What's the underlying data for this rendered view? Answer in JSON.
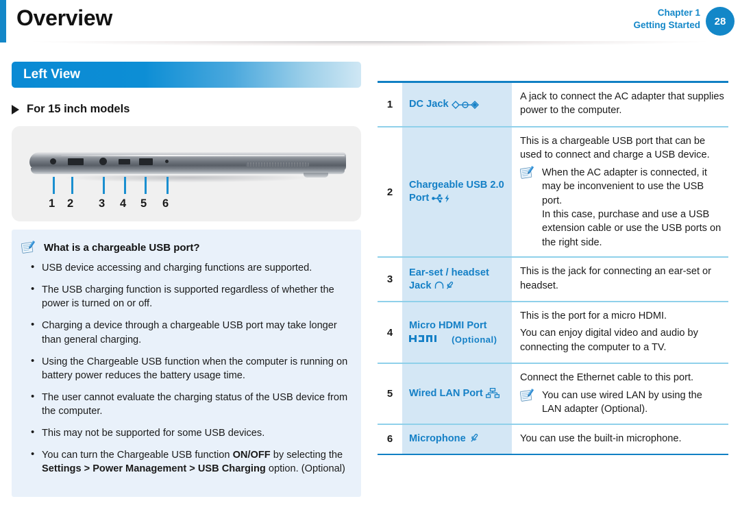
{
  "header": {
    "title": "Overview",
    "chapter": "Chapter 1",
    "subtitle": "Getting Started",
    "page_number": "28",
    "accent_color": "#1387c8"
  },
  "left": {
    "section_title": "Left View",
    "subheading": "For 15 inch models",
    "diagram": {
      "name": "laptop-left-side-view",
      "callout_numbers": [
        "1",
        "2",
        "3",
        "4",
        "5",
        "6"
      ]
    },
    "note": {
      "icon": "note-pen-icon",
      "title": "What is a chargeable USB port?",
      "bullets": [
        {
          "parts": [
            {
              "text": "USB device accessing and charging functions are supported.",
              "bold": false
            }
          ]
        },
        {
          "parts": [
            {
              "text": "The USB charging function is supported regardless of whether the power is turned on or off.",
              "bold": false
            }
          ]
        },
        {
          "parts": [
            {
              "text": "Charging a device through a chargeable USB port may take longer than general charging.",
              "bold": false
            }
          ]
        },
        {
          "parts": [
            {
              "text": "Using the Chargeable USB function when the computer is running on battery power reduces the battery usage time.",
              "bold": false
            }
          ]
        },
        {
          "parts": [
            {
              "text": "The user cannot evaluate the charging status of the USB device from the computer.",
              "bold": false
            }
          ]
        },
        {
          "parts": [
            {
              "text": "This may not be supported for some USB devices.",
              "bold": false
            }
          ]
        },
        {
          "parts": [
            {
              "text": "You can turn the Chargeable USB function ",
              "bold": false
            },
            {
              "text": "ON/OFF",
              "bold": true
            },
            {
              "text": " by selecting the ",
              "bold": false
            },
            {
              "text": "Settings > Power Management > USB Charging",
              "bold": true
            },
            {
              "text": " option. (Optional)",
              "bold": false
            }
          ]
        }
      ]
    }
  },
  "table": {
    "rows": [
      {
        "number": "1",
        "label": "DC Jack",
        "label_icon": "dc-jack-icon",
        "label_suffix": "",
        "desc_lines": [
          "A jack to connect the AC adapter that supplies power to the computer."
        ],
        "note": null
      },
      {
        "number": "2",
        "label": "Chargeable USB 2.0 Port",
        "label_icon": "usb-charging-icon",
        "label_suffix": "",
        "desc_lines": [
          "This is a chargeable USB port that can be used to connect and charge a USB device."
        ],
        "note": "When the AC adapter is connected, it may be inconvenient to use the USB port.\nIn this case, purchase and use a USB extension cable or use the USB ports on the right side."
      },
      {
        "number": "3",
        "label": "Ear-set / headset Jack",
        "label_icon": "headset-jack-icon",
        "label_suffix": "",
        "desc_lines": [
          "This is the jack for connecting an ear-set or headset."
        ],
        "note": null
      },
      {
        "number": "4",
        "label": "Micro HDMI Port",
        "label_icon": "hdmi-logo-icon",
        "label_suffix": "(Optional)",
        "desc_lines": [
          "This is the port for a micro HDMI.",
          "You can enjoy digital video and audio by connecting the computer to a TV."
        ],
        "note": null
      },
      {
        "number": "5",
        "label": "Wired LAN Port",
        "label_icon": "lan-port-icon",
        "label_suffix": "",
        "desc_lines": [
          "Connect the Ethernet cable to this port."
        ],
        "note": "You can use wired LAN by using the LAN adapter (Optional)."
      },
      {
        "number": "6",
        "label": "Microphone",
        "label_icon": "microphone-icon",
        "label_suffix": "",
        "desc_lines": [
          "You can use the built-in microphone."
        ],
        "note": null
      }
    ]
  }
}
